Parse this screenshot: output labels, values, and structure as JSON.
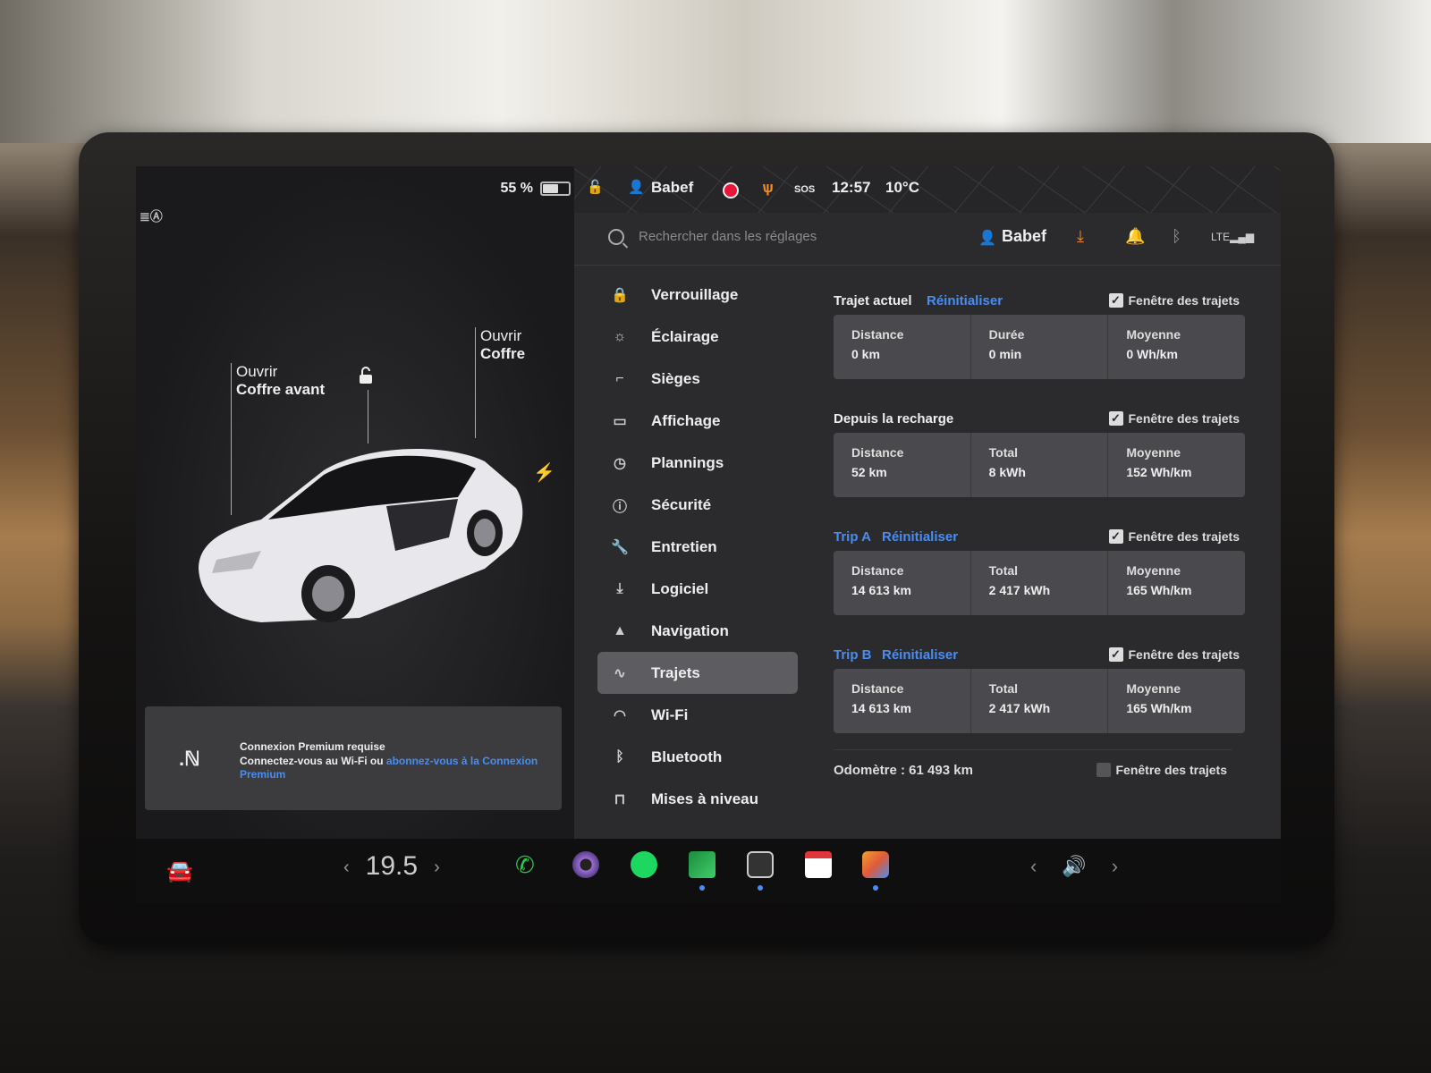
{
  "battery": {
    "percent": "55 %"
  },
  "car": {
    "frunk_label_1": "Ouvrir",
    "frunk_label_2": "Coffre avant",
    "trunk_label_1": "Ouvrir",
    "trunk_label_2": "Coffre"
  },
  "premium": {
    "title": "Connexion Premium requise",
    "text": "Connectez-vous au Wi-Fi ou ",
    "link": "abonnez-vous à la Connexion Premium"
  },
  "statusbar": {
    "user": "Babef",
    "time": "12:57",
    "temp": "10°C",
    "sos": "SOS"
  },
  "header": {
    "search_placeholder": "Rechercher dans les réglages",
    "user": "Babef"
  },
  "menu": [
    {
      "label": "Verrouillage",
      "icon": "lock-icon"
    },
    {
      "label": "Éclairage",
      "icon": "sun-icon"
    },
    {
      "label": "Sièges",
      "icon": "seat-icon"
    },
    {
      "label": "Affichage",
      "icon": "display-icon"
    },
    {
      "label": "Plannings",
      "icon": "clock-icon"
    },
    {
      "label": "Sécurité",
      "icon": "alert-icon"
    },
    {
      "label": "Entretien",
      "icon": "wrench-icon"
    },
    {
      "label": "Logiciel",
      "icon": "download-icon"
    },
    {
      "label": "Navigation",
      "icon": "navigation-icon"
    },
    {
      "label": "Trajets",
      "icon": "trips-icon"
    },
    {
      "label": "Wi-Fi",
      "icon": "wifi-icon"
    },
    {
      "label": "Bluetooth",
      "icon": "bluetooth-icon"
    },
    {
      "label": "Mises à niveau",
      "icon": "bag-icon"
    }
  ],
  "trips": {
    "window_label": "Fenêtre des trajets",
    "reset_label": "Réinitialiser",
    "current": {
      "title": "Trajet actuel",
      "k1": "Distance",
      "v1": "0 km",
      "k2": "Durée",
      "v2": "0 min",
      "k3": "Moyenne",
      "v3": "0 Wh/km"
    },
    "since_charge": {
      "title": "Depuis la recharge",
      "k1": "Distance",
      "v1": "52 km",
      "k2": "Total",
      "v2": "8 kWh",
      "k3": "Moyenne",
      "v3": "152 Wh/km"
    },
    "trip_a": {
      "title": "Trip A",
      "k1": "Distance",
      "v1": "14 613 km",
      "k2": "Total",
      "v2": "2 417 kWh",
      "k3": "Moyenne",
      "v3": "165 Wh/km"
    },
    "trip_b": {
      "title": "Trip B",
      "k1": "Distance",
      "v1": "14 613 km",
      "k2": "Total",
      "v2": "2 417 kWh",
      "k3": "Moyenne",
      "v3": "165 Wh/km"
    },
    "odometer": "Odomètre : 61 493 km"
  },
  "dock": {
    "temperature": "19.5"
  },
  "colors": {
    "accent": "#4a8df0",
    "active_menu": "#5d5d61",
    "panel": "#2b2b2e",
    "card": "#4a4a4e"
  }
}
